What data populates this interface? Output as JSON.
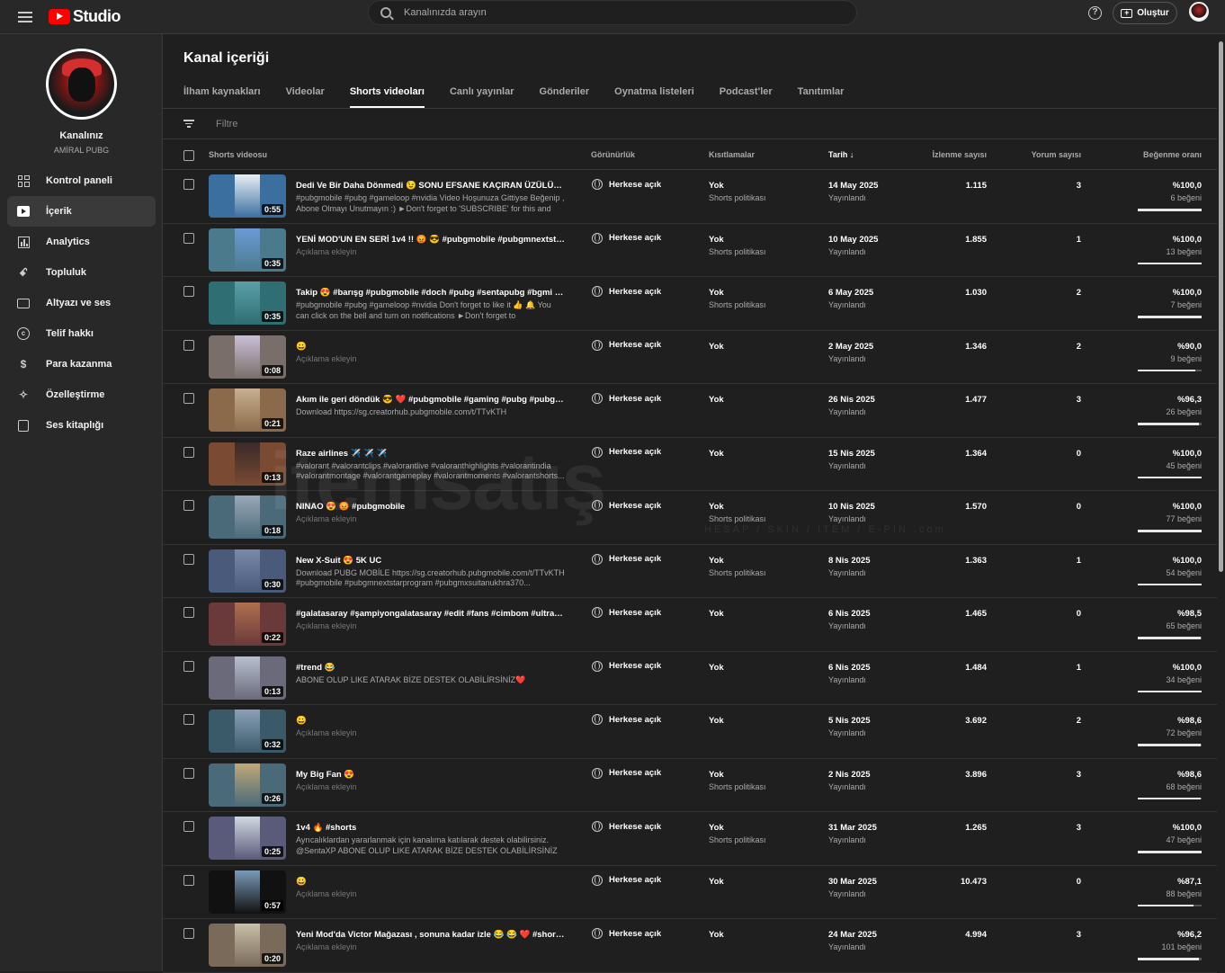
{
  "topbar": {
    "app_name": "Studio",
    "search_placeholder": "Kanalınızda arayın",
    "help_icon": "?",
    "create_label": "Oluştur"
  },
  "sidebar": {
    "channel_title": "Kanalınız",
    "channel_name": "AMİRAL PUBG",
    "items": [
      {
        "label": "Kontrol paneli",
        "icon": "dashboard-icon"
      },
      {
        "label": "İçerik",
        "icon": "content-icon",
        "active": true
      },
      {
        "label": "Analytics",
        "icon": "analytics-icon"
      },
      {
        "label": "Topluluk",
        "icon": "community-icon"
      },
      {
        "label": "Altyazı ve ses",
        "icon": "subtitles-icon"
      },
      {
        "label": "Telif hakkı",
        "icon": "copyright-icon"
      },
      {
        "label": "Para kazanma",
        "icon": "monetization-icon"
      },
      {
        "label": "Özelleştirme",
        "icon": "customization-icon"
      },
      {
        "label": "Ses kitaplığı",
        "icon": "audio-library-icon"
      }
    ]
  },
  "main": {
    "title": "Kanal içeriği",
    "tabs": [
      "İlham kaynakları",
      "Videolar",
      "Shorts videoları",
      "Canlı yayınlar",
      "Gönderiler",
      "Oynatma listeleri",
      "Podcast'ler",
      "Tanıtımlar"
    ],
    "active_tab": 2,
    "filter_placeholder": "Filtre",
    "columns": {
      "video": "Shorts videosu",
      "visibility": "Görünürlük",
      "restrictions": "Kısıtlamalar",
      "date": "Tarih",
      "views": "İzlenme sayısı",
      "comments": "Yorum sayısı",
      "likes": "Beğenme oranı"
    }
  },
  "rows": [
    {
      "title": "Dedi Ve Bir Daha Dönmedi 😉 SONU EFSANE KAÇIRAN ÜZÜLÜR 😡 😂 ...",
      "desc": "#pubgmobile #pubg #gameloop #nvidia Video Hoşunuza Gittiyse Beğenip , Abone Olmayı Unutmayın :) ►Don't forget to 'SUBSCRIBE' for this and simila...",
      "empty_desc": false,
      "duration": "0:55",
      "visibility": "Herkese açık",
      "restriction": "Yok",
      "restriction_sub": "Shorts politikası",
      "date": "14 May 2025",
      "status": "Yayınlandı",
      "views": "1.115",
      "comments": "3",
      "ratio": "%100,0",
      "likes": "6 beğeni",
      "like_fraction": 1.0,
      "c1": "#3b6fa0",
      "c2": "#e8eef5"
    },
    {
      "title": "YENİ MOD'UN EN SERİ 1v4 !! 😡 😎 #pubgmobile #pubgmnextstarprogr...",
      "desc": "Açıklama ekleyin",
      "empty_desc": true,
      "duration": "0:35",
      "visibility": "Herkese açık",
      "restriction": "Yok",
      "restriction_sub": "Shorts politikası",
      "date": "10 May 2025",
      "status": "Yayınlandı",
      "views": "1.855",
      "comments": "1",
      "ratio": "%100,0",
      "likes": "13 beğeni",
      "like_fraction": 1.0,
      "c1": "#4a7a8c",
      "c2": "#6b9ad6"
    },
    {
      "title": "Takip 😍 #barışg #pubgmobile #doch #pubg #sentapubg #bgmi #gami...",
      "desc": "#pubgmobile #pubg #gameloop #nvidia Don't forget to like it 👍 🔔 You can click on the bell and turn on notifications ►Don't forget to 'SUBSCRIBE' for...",
      "empty_desc": false,
      "duration": "0:35",
      "visibility": "Herkese açık",
      "restriction": "Yok",
      "restriction_sub": "Shorts politikası",
      "date": "6 May 2025",
      "status": "Yayınlandı",
      "views": "1.030",
      "comments": "2",
      "ratio": "%100,0",
      "likes": "7 beğeni",
      "like_fraction": 1.0,
      "c1": "#2f6e73",
      "c2": "#5aa0a8"
    },
    {
      "title": "😀",
      "desc": "Açıklama ekleyin",
      "empty_desc": true,
      "duration": "0:08",
      "visibility": "Herkese açık",
      "restriction": "Yok",
      "restriction_sub": "",
      "date": "2 May 2025",
      "status": "Yayınlandı",
      "views": "1.346",
      "comments": "2",
      "ratio": "%90,0",
      "likes": "9 beğeni",
      "like_fraction": 0.9,
      "c1": "#7a6e6a",
      "c2": "#c9c0d8"
    },
    {
      "title": "Akım ile geri döndük 😎 ❤️ #pubgmobile #gaming #pubg #pubgmnexts...",
      "desc": "Download https://sg.creatorhub.pubgmobile.com/t/TTvKTH",
      "empty_desc": false,
      "duration": "0:21",
      "visibility": "Herkese açık",
      "restriction": "Yok",
      "restriction_sub": "",
      "date": "26 Nis 2025",
      "status": "Yayınlandı",
      "views": "1.477",
      "comments": "3",
      "ratio": "%96,3",
      "likes": "26 beğeni",
      "like_fraction": 0.963,
      "c1": "#8a6a4a",
      "c2": "#c8b090"
    },
    {
      "title": "Raze airlines ✈️ ✈️ ✈️",
      "desc": "#valorant #valorantclips #valorantlive #valoranthighlights #valorantindia #valorantmontage #valorantgameplay #valorantmoments #valorantshorts...",
      "empty_desc": false,
      "duration": "0:13",
      "visibility": "Herkese açık",
      "restriction": "Yok",
      "restriction_sub": "",
      "date": "15 Nis 2025",
      "status": "Yayınlandı",
      "views": "1.364",
      "comments": "0",
      "ratio": "%100,0",
      "likes": "45 beğeni",
      "like_fraction": 1.0,
      "c1": "#7a4a32",
      "c2": "#3a2a2a"
    },
    {
      "title": "NINAO 😍 😡 #pubgmobile",
      "desc": "Açıklama ekleyin",
      "empty_desc": true,
      "duration": "0:18",
      "visibility": "Herkese açık",
      "restriction": "Yok",
      "restriction_sub": "Shorts politikası",
      "date": "10 Nis 2025",
      "status": "Yayınlandı",
      "views": "1.570",
      "comments": "0",
      "ratio": "%100,0",
      "likes": "77 beğeni",
      "like_fraction": 1.0,
      "c1": "#4a6a7a",
      "c2": "#9aa8b8"
    },
    {
      "title": "New X-Suit 😍 5K UC",
      "desc": "Download PUBG MOBİLE https://sg.creatorhub.pubgmobile.com/t/TTvKTH #pubgmobile #pubgmnextstarprogram #pubgmxsuitanukhra370...",
      "empty_desc": false,
      "duration": "0:30",
      "visibility": "Herkese açık",
      "restriction": "Yok",
      "restriction_sub": "Shorts politikası",
      "date": "8 Nis 2025",
      "status": "Yayınlandı",
      "views": "1.363",
      "comments": "1",
      "ratio": "%100,0",
      "likes": "54 beğeni",
      "like_fraction": 1.0,
      "c1": "#4a5a7a",
      "c2": "#7a8aaa"
    },
    {
      "title": "#galatasaray #şampiyongalatasaray #edit #fans #cimbom #ultraslan",
      "desc": "Açıklama ekleyin",
      "empty_desc": true,
      "duration": "0:22",
      "visibility": "Herkese açık",
      "restriction": "Yok",
      "restriction_sub": "",
      "date": "6 Nis 2025",
      "status": "Yayınlandı",
      "views": "1.465",
      "comments": "0",
      "ratio": "%98,5",
      "likes": "65 beğeni",
      "like_fraction": 0.985,
      "c1": "#6a3a3a",
      "c2": "#b07050"
    },
    {
      "title": "#trend 😂",
      "desc": "ABONE OLUP LIKE ATARAK BİZE DESTEK OLABİLİRSİNİZ❤️",
      "empty_desc": false,
      "duration": "0:13",
      "visibility": "Herkese açık",
      "restriction": "Yok",
      "restriction_sub": "",
      "date": "6 Nis 2025",
      "status": "Yayınlandı",
      "views": "1.484",
      "comments": "1",
      "ratio": "%100,0",
      "likes": "34 beğeni",
      "like_fraction": 1.0,
      "c1": "#6a6a7a",
      "c2": "#b8c0d0"
    },
    {
      "title": "😀",
      "desc": "Açıklama ekleyin",
      "empty_desc": true,
      "duration": "0:32",
      "visibility": "Herkese açık",
      "restriction": "Yok",
      "restriction_sub": "",
      "date": "5 Nis 2025",
      "status": "Yayınlandı",
      "views": "3.692",
      "comments": "2",
      "ratio": "%98,6",
      "likes": "72 beğeni",
      "like_fraction": 0.986,
      "c1": "#3a5a6a",
      "c2": "#8aa0b8"
    },
    {
      "title": "My Big Fan 😍",
      "desc": "Açıklama ekleyin",
      "empty_desc": true,
      "duration": "0:26",
      "visibility": "Herkese açık",
      "restriction": "Yok",
      "restriction_sub": "Shorts politikası",
      "date": "2 Nis 2025",
      "status": "Yayınlandı",
      "views": "3.896",
      "comments": "3",
      "ratio": "%98,6",
      "likes": "68 beğeni",
      "like_fraction": 0.986,
      "c1": "#4a6a7a",
      "c2": "#c0a878"
    },
    {
      "title": "1v4 🔥 #shorts",
      "desc": "Ayrıcalıklardan yararlanmak için kanalıma katılarak destek olabilirsiniz. @SentaXP ABONE OLUP LIKE ATARAK BİZE DESTEK OLABİLİRSİNİZ❤️",
      "empty_desc": false,
      "duration": "0:25",
      "visibility": "Herkese açık",
      "restriction": "Yok",
      "restriction_sub": "Shorts politikası",
      "date": "31 Mar 2025",
      "status": "Yayınlandı",
      "views": "1.265",
      "comments": "3",
      "ratio": "%100,0",
      "likes": "47 beğeni",
      "like_fraction": 1.0,
      "c1": "#5a5a7a",
      "c2": "#d0d8e0"
    },
    {
      "title": "😀",
      "desc": "Açıklama ekleyin",
      "empty_desc": true,
      "duration": "0:57",
      "visibility": "Herkese açık",
      "restriction": "Yok",
      "restriction_sub": "",
      "date": "30 Mar 2025",
      "status": "Yayınlandı",
      "views": "10.473",
      "comments": "0",
      "ratio": "%87,1",
      "likes": "88 beğeni",
      "like_fraction": 0.871,
      "c1": "#111111",
      "c2": "#7a9ab8"
    },
    {
      "title": "Yeni Mod'da Victor Mağazası , sonuna kadar izle 😂 😂 ❤️ #shorts #pu...",
      "desc": "Açıklama ekleyin",
      "empty_desc": true,
      "duration": "0:20",
      "visibility": "Herkese açık",
      "restriction": "Yok",
      "restriction_sub": "",
      "date": "24 Mar 2025",
      "status": "Yayınlandı",
      "views": "4.994",
      "comments": "3",
      "ratio": "%96,2",
      "likes": "101 beğeni",
      "like_fraction": 0.962,
      "c1": "#7a6a5a",
      "c2": "#c8c0a8"
    }
  ],
  "watermark": {
    "text": "itemsatış",
    "sub": "HESAP / SKIN / ITEM / E-PIN .com"
  }
}
